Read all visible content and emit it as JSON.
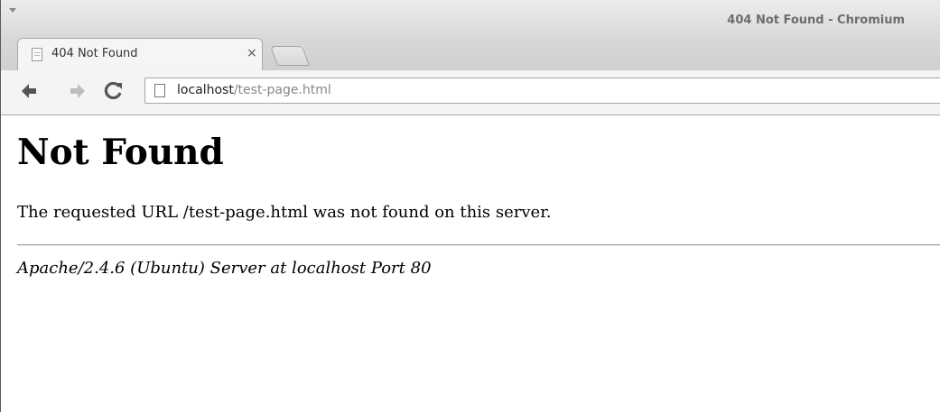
{
  "window": {
    "title": "404 Not Found - Chromium"
  },
  "tab": {
    "title": "404 Not Found",
    "close": "×"
  },
  "toolbar": {
    "back": "🡐",
    "forward": "🡒",
    "reload": "C"
  },
  "address_bar": {
    "host": "localhost",
    "path": "/test-page.html"
  },
  "page": {
    "heading": "Not Found",
    "message": "The requested URL /test-page.html was not found on this server.",
    "footer": "Apache/2.4.6 (Ubuntu) Server at localhost Port 80"
  }
}
